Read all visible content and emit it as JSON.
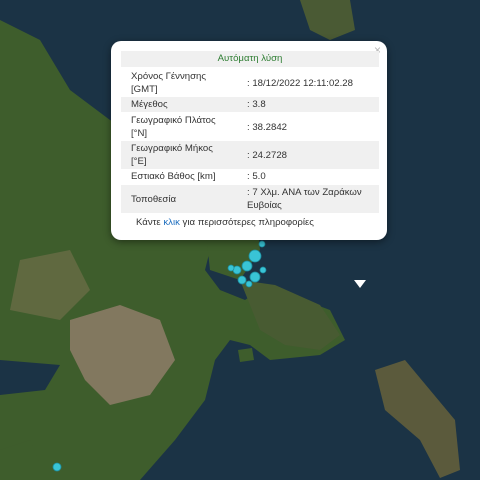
{
  "popup": {
    "close_label": "×",
    "title": "Αυτόματη λύση",
    "rows": [
      {
        "label": "Χρόνος Γέννησης [GMT]",
        "value": ": 18/12/2022 12:11:02.28"
      },
      {
        "label": "Μέγεθος",
        "value": ": 3.8"
      },
      {
        "label": "Γεωγραφικό Πλάτος [°N]",
        "value": ": 38.2842"
      },
      {
        "label": "Γεωγραφικό Μήκος [°E]",
        "value": ": 24.2728"
      },
      {
        "label": "Εστιακό Βάθος [km]",
        "value": ": 5.0"
      },
      {
        "label": "Τοποθεσία",
        "value": ": 7 Χλμ. ΑΝΑ των Ζαράκων Ευβοίας"
      }
    ],
    "more_prefix": "Κάντε ",
    "more_link": "κλικ",
    "more_suffix": " για περισσότερες πληροφορίες"
  },
  "colors": {
    "sea": "#1b3345",
    "land": "#3c5a2c",
    "urban": "#8e7c68",
    "marker": "#39c4d6",
    "popup_title_text": "#2e7d32",
    "link": "#1f6fbf"
  },
  "icons": [
    "close-icon",
    "earthquake-marker-icon"
  ]
}
